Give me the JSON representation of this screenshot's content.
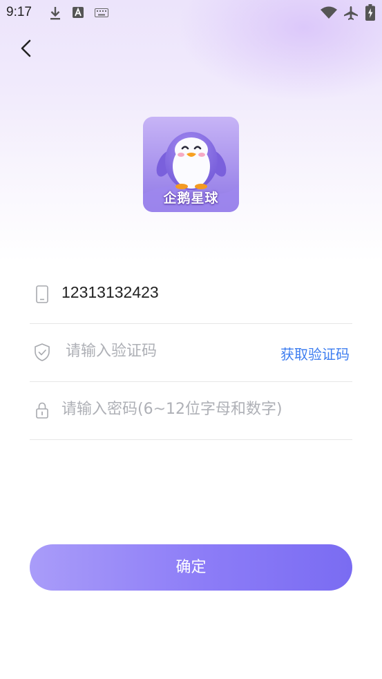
{
  "status_bar": {
    "time": "9:17",
    "left_icons": [
      "download-icon",
      "font-a-icon",
      "keyboard-icon"
    ],
    "right_icons": [
      "wifi-icon",
      "airplane-icon",
      "battery-charging-icon"
    ]
  },
  "header": {
    "back_icon": "chevron-left-icon"
  },
  "logo": {
    "text": "企鹅星球"
  },
  "form": {
    "phone": {
      "value": "12313132423",
      "icon": "phone-icon"
    },
    "code": {
      "placeholder": "请输入验证码",
      "icon": "shield-check-icon",
      "get_code_label": "获取验证码"
    },
    "password": {
      "placeholder": "请输入密码(6~12位字母和数字)",
      "icon": "lock-icon"
    }
  },
  "confirm_label": "确定",
  "colors": {
    "accent": "#8c7cf7",
    "link": "#3d7df0",
    "placeholder": "#aeb0b6"
  }
}
